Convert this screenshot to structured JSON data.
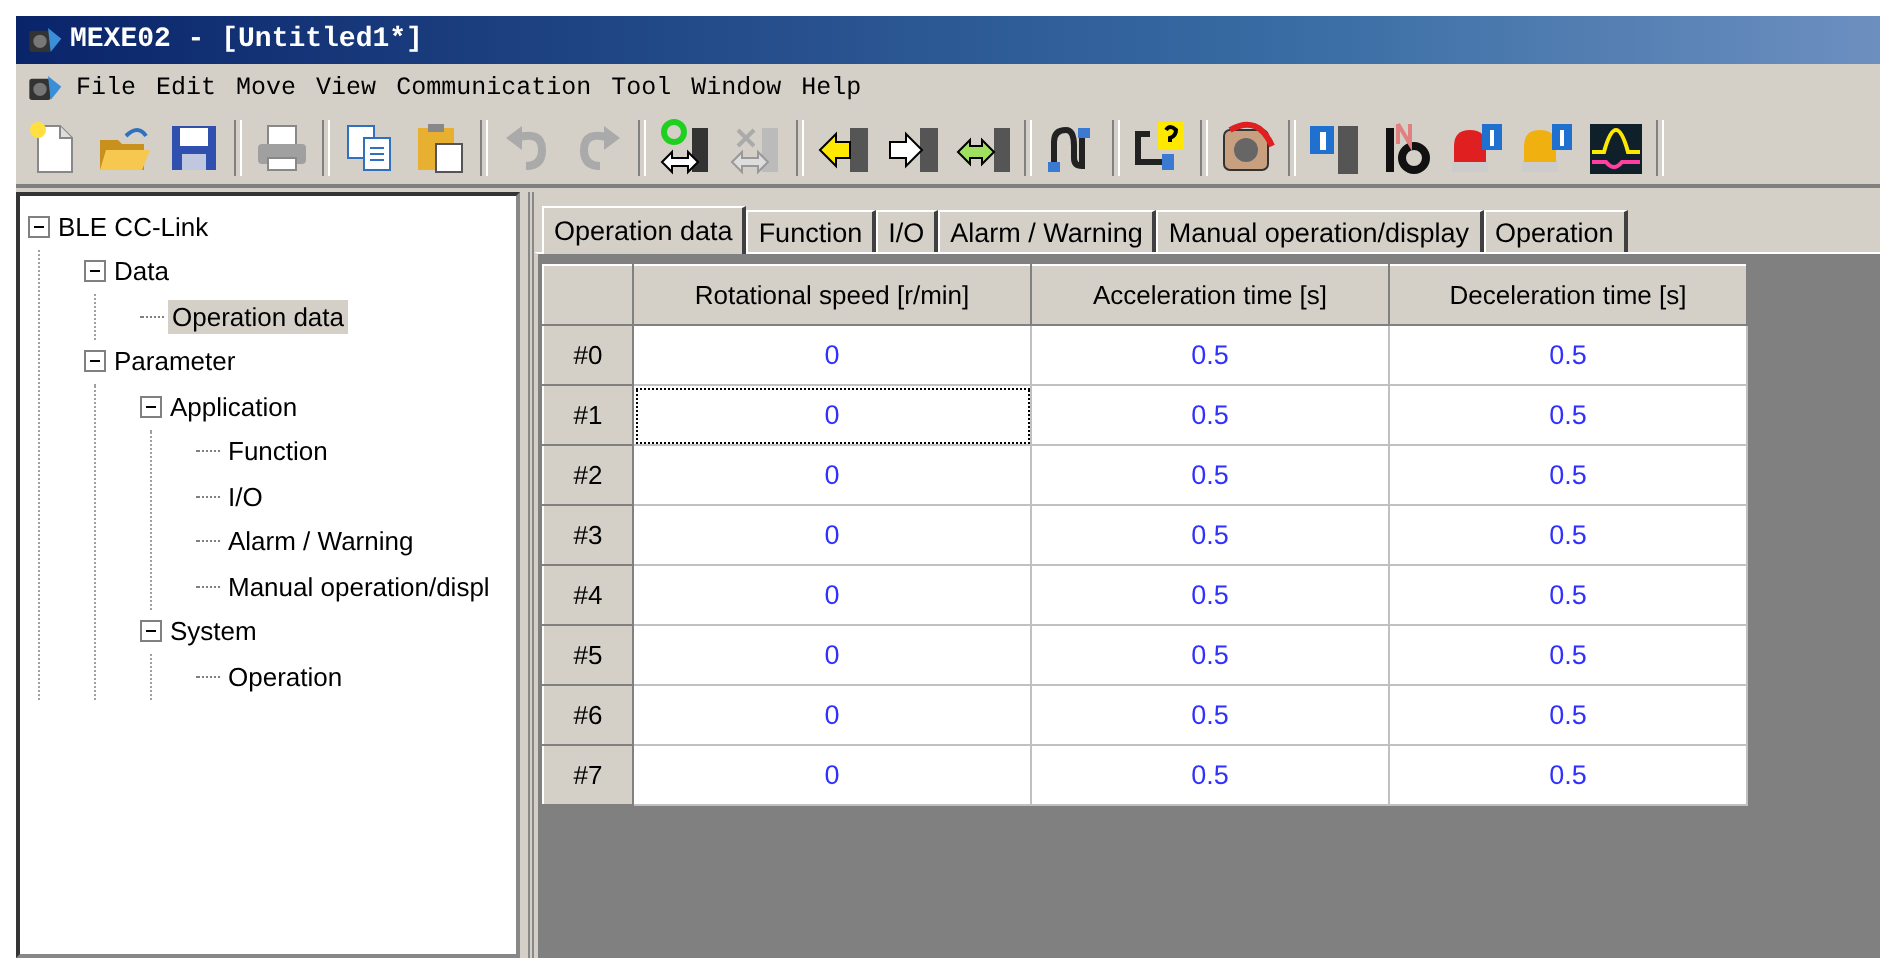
{
  "window": {
    "title": "MEXE02 - [Untitled1*]"
  },
  "menu": [
    {
      "label": "File"
    },
    {
      "label": "Edit"
    },
    {
      "label": "Move"
    },
    {
      "label": "View"
    },
    {
      "label": "Communication"
    },
    {
      "label": "Tool"
    },
    {
      "label": "Window"
    },
    {
      "label": "Help"
    }
  ],
  "tree": [
    {
      "label": "BLE CC-Link",
      "expanded": true,
      "selected": false,
      "children": [
        {
          "label": "Data",
          "expanded": true,
          "selected": false,
          "children": [
            {
              "label": "Operation data",
              "selected": true
            }
          ]
        },
        {
          "label": "Parameter",
          "expanded": true,
          "selected": false,
          "children": [
            {
              "label": "Application",
              "expanded": true,
              "selected": false,
              "children": [
                {
                  "label": "Function",
                  "selected": false
                },
                {
                  "label": "I/O",
                  "selected": false
                },
                {
                  "label": "Alarm / Warning",
                  "selected": false
                },
                {
                  "label": "Manual operation/displ",
                  "selected": false
                }
              ]
            },
            {
              "label": "System",
              "expanded": true,
              "selected": false,
              "children": [
                {
                  "label": "Operation",
                  "selected": false
                }
              ]
            }
          ]
        }
      ]
    }
  ],
  "tabs": [
    {
      "label": "Operation data",
      "selected": true
    },
    {
      "label": "Function",
      "selected": false
    },
    {
      "label": "I/O",
      "selected": false
    },
    {
      "label": "Alarm / Warning",
      "selected": false
    },
    {
      "label": "Manual operation/display",
      "selected": false
    },
    {
      "label": "Operation",
      "selected": false
    }
  ],
  "table": {
    "columns": [
      "Rotational speed [r/min]",
      "Acceleration time [s]",
      "Deceleration time [s]"
    ],
    "rows": [
      {
        "label": "#0",
        "cells": [
          {
            "value": "0",
            "focused": false
          },
          {
            "value": "0.5",
            "focused": false
          },
          {
            "value": "0.5",
            "focused": false
          }
        ]
      },
      {
        "label": "#1",
        "cells": [
          {
            "value": "0",
            "focused": true
          },
          {
            "value": "0.5",
            "focused": false
          },
          {
            "value": "0.5",
            "focused": false
          }
        ]
      },
      {
        "label": "#2",
        "cells": [
          {
            "value": "0",
            "focused": false
          },
          {
            "value": "0.5",
            "focused": false
          },
          {
            "value": "0.5",
            "focused": false
          }
        ]
      },
      {
        "label": "#3",
        "cells": [
          {
            "value": "0",
            "focused": false
          },
          {
            "value": "0.5",
            "focused": false
          },
          {
            "value": "0.5",
            "focused": false
          }
        ]
      },
      {
        "label": "#4",
        "cells": [
          {
            "value": "0",
            "focused": false
          },
          {
            "value": "0.5",
            "focused": false
          },
          {
            "value": "0.5",
            "focused": false
          }
        ]
      },
      {
        "label": "#5",
        "cells": [
          {
            "value": "0",
            "focused": false
          },
          {
            "value": "0.5",
            "focused": false
          },
          {
            "value": "0.5",
            "focused": false
          }
        ]
      },
      {
        "label": "#6",
        "cells": [
          {
            "value": "0",
            "focused": false
          },
          {
            "value": "0.5",
            "focused": false
          },
          {
            "value": "0.5",
            "focused": false
          }
        ]
      },
      {
        "label": "#7",
        "cells": [
          {
            "value": "0",
            "focused": false
          },
          {
            "value": "0.5",
            "focused": false
          },
          {
            "value": "0.5",
            "focused": false
          }
        ]
      }
    ]
  }
}
